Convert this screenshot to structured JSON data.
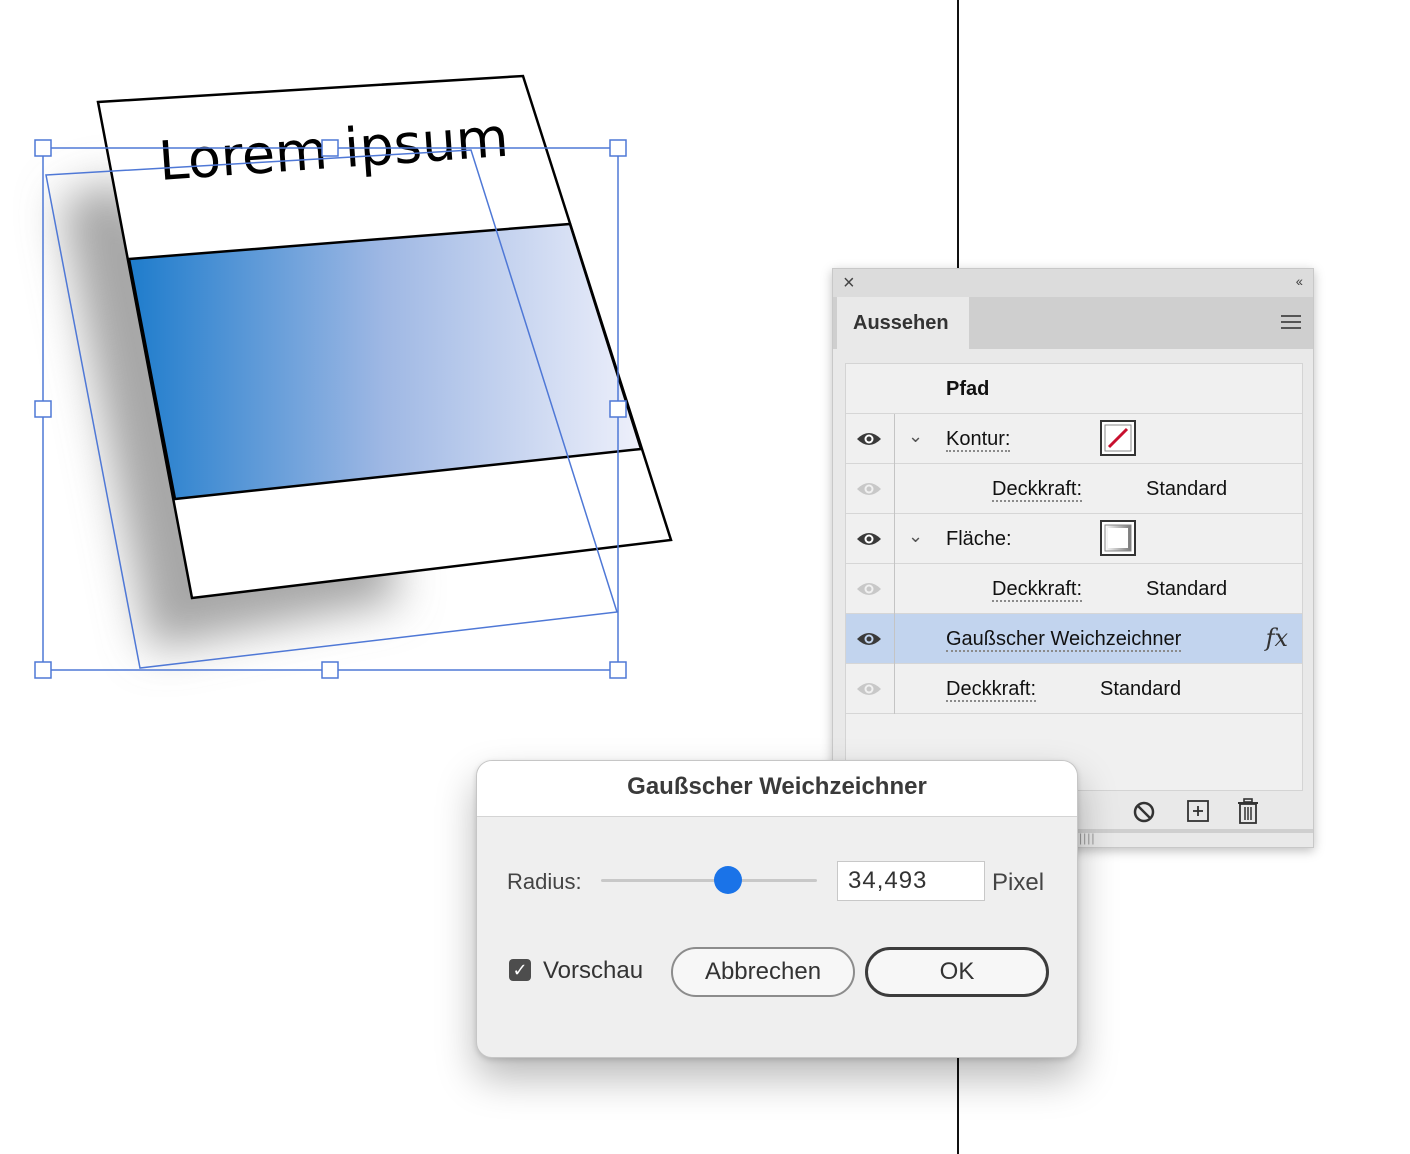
{
  "canvas": {
    "headline": "Lorem ipsum"
  },
  "appearance_panel": {
    "close_glyph": "×",
    "collapse_glyph": "‹‹",
    "tab_label": "Aussehen",
    "menu_icon": "hamburger-icon",
    "object_type": "Pfad",
    "rows": [
      {
        "label": "Kontur:",
        "value": "",
        "icon": "eye-icon",
        "visible": true,
        "expandable": true,
        "swatch": "stroke-none"
      },
      {
        "label": "Deckkraft:",
        "value": "Standard",
        "icon": "eye-icon",
        "visible": false
      },
      {
        "label": "Fläche:",
        "value": "",
        "icon": "eye-icon",
        "visible": true,
        "expandable": true,
        "swatch": "gradient-fill"
      },
      {
        "label": "Deckkraft:",
        "value": "Standard",
        "icon": "eye-icon",
        "visible": false
      },
      {
        "label": "Gaußscher Weichzeichner",
        "value": "",
        "icon": "eye-icon",
        "visible": true,
        "selected": true,
        "fx": "fx"
      },
      {
        "label": "Deckkraft:",
        "value": "Standard",
        "icon": "eye-icon",
        "visible": false
      }
    ],
    "bottom_icons": [
      "clear-appearance-icon",
      "duplicate-item-icon",
      "delete-item-icon"
    ]
  },
  "dialog": {
    "title": "Gaußscher Weichzeichner",
    "radius_label": "Radius:",
    "radius_value": "34,493",
    "radius_slider_fraction": 0.59,
    "unit": "Pixel",
    "preview_label": "Vorschau",
    "preview_checked": true,
    "cancel_label": "Abbrechen",
    "ok_label": "OK"
  },
  "colors": {
    "selection_blue": "#4f78d6",
    "gradient_start": "#1e7ccc",
    "gradient_end": "#eef0fb",
    "slider_thumb": "#1a73e8",
    "selected_row": "#c2d4ee"
  }
}
